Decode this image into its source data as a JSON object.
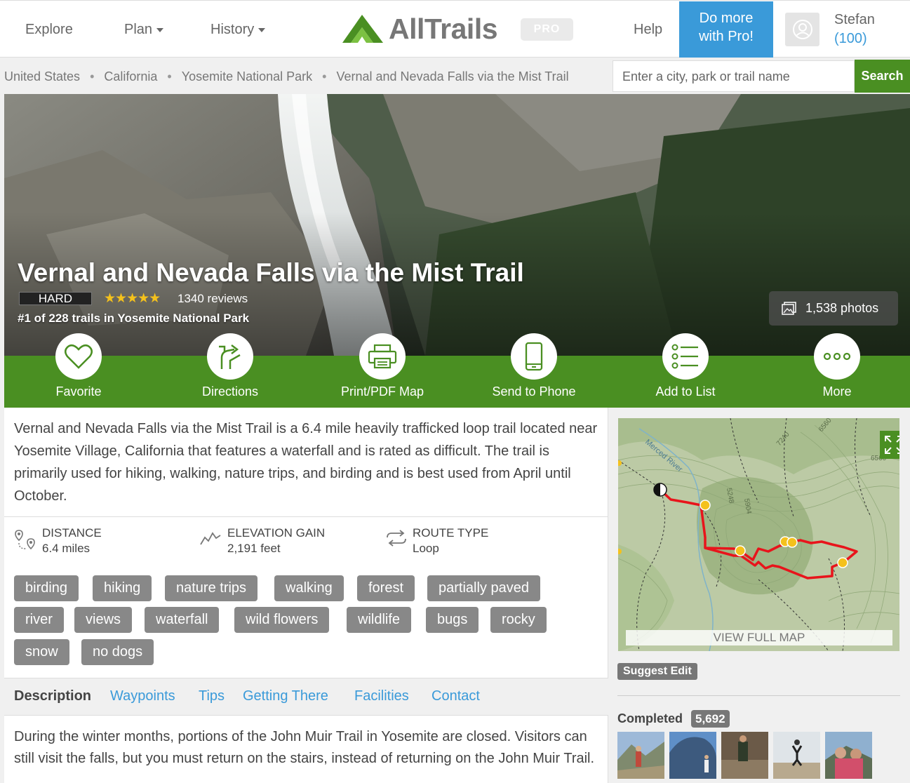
{
  "nav": {
    "explore": "Explore",
    "plan": "Plan",
    "history": "History",
    "logo_text": "AllTrails",
    "pro_badge": "PRO",
    "help": "Help",
    "do_more_line1": "Do more",
    "do_more_line2": "with Pro!",
    "user_name": "Stefan",
    "user_points": "(100)"
  },
  "breadcrumb": [
    "United States",
    "California",
    "Yosemite National Park",
    "Vernal and Nevada Falls via the Mist Trail"
  ],
  "search": {
    "placeholder": "Enter a city, park or trail name",
    "button": "Search"
  },
  "hero": {
    "title": "Vernal and Nevada Falls via the Mist Trail",
    "difficulty": "HARD",
    "stars": "★★★★★",
    "reviews": "1340 reviews",
    "rank": "#1 of 228 trails in Yosemite National Park",
    "photos": "1,538 photos"
  },
  "actions": [
    "Favorite",
    "Directions",
    "Print/PDF Map",
    "Send to Phone",
    "Add to List",
    "More"
  ],
  "summary": "Vernal and Nevada Falls via the Mist Trail is a 6.4 mile heavily trafficked loop trail located near Yosemite Village, California that features a waterfall and is rated as difficult. The trail is primarily used for hiking, walking, nature trips, and birding and is best used from April until October.",
  "stats": {
    "distance_label": "DISTANCE",
    "distance_value": "6.4 miles",
    "elevation_label": "ELEVATION GAIN",
    "elevation_value": "2,191 feet",
    "route_label": "ROUTE TYPE",
    "route_value": "Loop"
  },
  "tags": [
    "birding",
    "hiking",
    "nature trips",
    "walking",
    "forest",
    "partially paved",
    "river",
    "views",
    "waterfall",
    "wild flowers",
    "wildlife",
    "bugs",
    "rocky",
    "snow",
    "no dogs"
  ],
  "tabs": [
    "Description",
    "Waypoints",
    "Tips",
    "Getting There",
    "Facilities",
    "Contact"
  ],
  "description": "During the winter months, portions of the John Muir Trail in Yosemite are closed. Visitors can still visit the falls, but you must return on the stairs, instead of returning on the John Muir Trail.",
  "map": {
    "view_full": "VIEW FULL MAP",
    "labels": [
      "Merced River",
      "6560",
      "7240",
      "6560",
      "5248",
      "5904"
    ]
  },
  "sidebar": {
    "suggest_edit": "Suggest Edit",
    "completed_label": "Completed",
    "completed_count": "5,692"
  },
  "colors": {
    "brand_green": "#4a8f22",
    "link_blue": "#3a9ad9",
    "tag_gray": "#888888",
    "star_yellow": "#f4c11c",
    "route_red": "#e8141b"
  }
}
